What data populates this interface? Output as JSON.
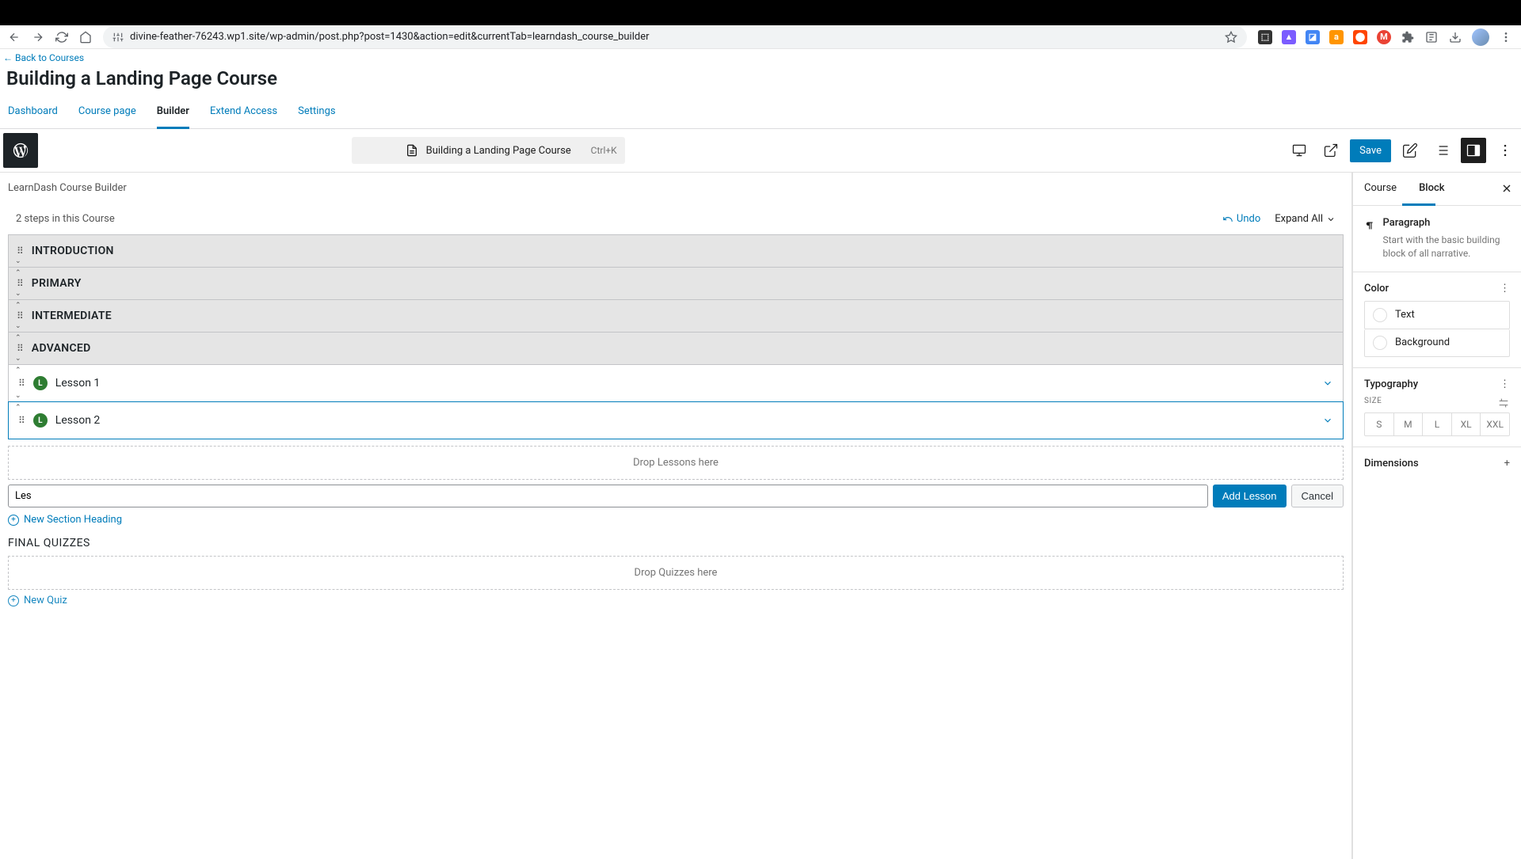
{
  "browser": {
    "url": "divine-feather-76243.wp1.site/wp-admin/post.php?post=1430&action=edit&currentTab=learndash_course_builder"
  },
  "header": {
    "back_link": "← Back to Courses",
    "page_title": "Building a Landing Page Course"
  },
  "tabs": [
    {
      "label": "Dashboard",
      "active": false
    },
    {
      "label": "Course page",
      "active": false
    },
    {
      "label": "Builder",
      "active": true
    },
    {
      "label": "Extend Access",
      "active": false
    },
    {
      "label": "Settings",
      "active": false
    }
  ],
  "editor": {
    "command_title": "Building a Landing Page Course",
    "command_kbd": "Ctrl+K",
    "save_label": "Save"
  },
  "builder": {
    "label": "LearnDash Course Builder",
    "steps_text": "2 steps in this Course",
    "undo_label": "Undo",
    "expand_label": "Expand All",
    "sections": [
      {
        "title": "INTRODUCTION"
      },
      {
        "title": "PRIMARY"
      },
      {
        "title": "INTERMEDIATE"
      },
      {
        "title": "ADVANCED"
      }
    ],
    "lessons": [
      {
        "title": "Lesson 1",
        "selected": false
      },
      {
        "title": "Lesson 2",
        "selected": true
      }
    ],
    "drop_lessons_text": "Drop Lessons here",
    "new_lesson_value": "Les",
    "add_lesson_label": "Add Lesson",
    "cancel_label": "Cancel",
    "new_section_label": "New Section Heading",
    "final_quizzes_label": "FINAL QUIZZES",
    "drop_quizzes_text": "Drop Quizzes here",
    "new_quiz_label": "New Quiz"
  },
  "sidebar": {
    "tabs": {
      "course": "Course",
      "block": "Block"
    },
    "block_name": "Paragraph",
    "block_desc": "Start with the basic building block of all narrative.",
    "color_label": "Color",
    "text_label": "Text",
    "background_label": "Background",
    "typography_label": "Typography",
    "size_label": "SIZE",
    "sizes": [
      "S",
      "M",
      "L",
      "XL",
      "XXL"
    ],
    "dimensions_label": "Dimensions"
  }
}
